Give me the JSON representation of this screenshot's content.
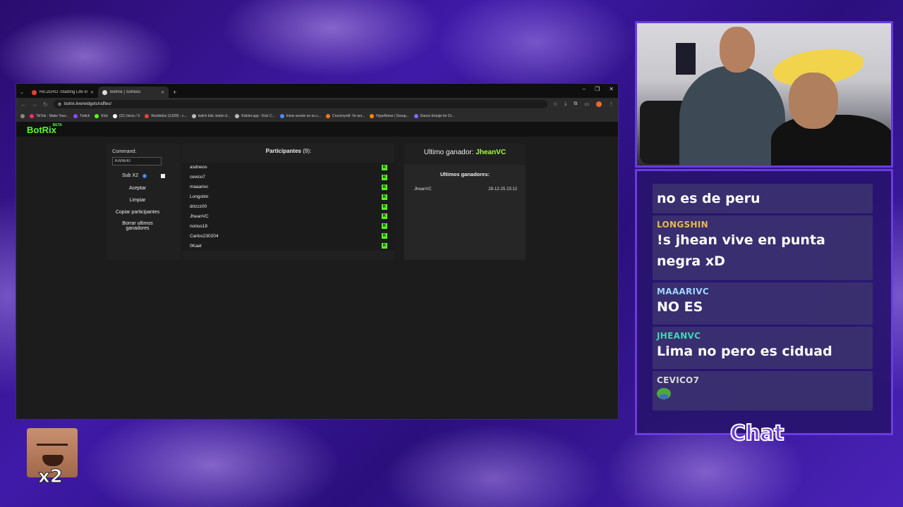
{
  "browser": {
    "tabs": [
      {
        "title": "Re:ZERO -Starting Life in Anoth",
        "favicon_color": "#e8442c",
        "active": false
      },
      {
        "title": "BotRix | Sorteos",
        "favicon_color": "#dddddd",
        "active": true
      }
    ],
    "url": "botrix.live/widgets/raffles/",
    "bookmarks": [
      {
        "label": "TikTok - Make Your...",
        "color": "#ff2a6d"
      },
      {
        "label": "Twitch",
        "color": "#9146ff"
      },
      {
        "label": "Kick",
        "color": "#53fc18"
      },
      {
        "label": "(31) Inicio / X",
        "color": "#ffffff"
      },
      {
        "label": "Recibidos (3,628) - c...",
        "color": "#ea4335"
      },
      {
        "label": "twitch bits: botón d...",
        "color": "#bbbbbb"
      },
      {
        "label": "Kicklet.app - Kick C...",
        "color": "#bbbbbb"
      },
      {
        "label": "Inicie sesión en su c...",
        "color": "#4a8cff"
      },
      {
        "label": "Crunchyroll: Ve ani...",
        "color": "#f47521"
      },
      {
        "label": "HypeNoise | Group...",
        "color": "#ff8a00"
      },
      {
        "label": "Dance Emojis for Di...",
        "color": "#7b6cff"
      }
    ]
  },
  "site": {
    "logo": "BotRix",
    "logo_badge": "BETA"
  },
  "raffle": {
    "command_label": "Command:",
    "command_value": "KANEKI",
    "sub_label": "Sub X2",
    "accept_label": "Aceptar",
    "clear_label": "Limpiar",
    "copy_label": "Copiar participantes",
    "delete_winners_label": "Borrar ultimos ganadores",
    "participants_title": "Participantes",
    "participants_count": "(9):",
    "participants": [
      "asdneos",
      "cevico7",
      "maaarivc",
      "Longshin",
      "drizzz00",
      "JheanVC",
      "norius18",
      "Carlos230204",
      "0Kael"
    ],
    "last_winner_label": "Ultimo ganador:",
    "last_winner": "JheanVC",
    "recent_winners_title": "Ultimos ganadores:",
    "recent_winners": [
      {
        "name": "JheanVC",
        "date": "28-12-25 23:12"
      }
    ]
  },
  "chat": {
    "label": "Chat",
    "messages": [
      {
        "user": "",
        "user_color": "#ffffff",
        "text": "no es de peru"
      },
      {
        "user": "LONGSHIN",
        "user_color": "#e8b94a",
        "text": "!s jhean vive en punta negra xD"
      },
      {
        "user": "MAAARIVC",
        "user_color": "#9fd4ff",
        "text": "NO ES"
      },
      {
        "user": "JHEANVC",
        "user_color": "#3fd6b4",
        "text": "Lima no pero es ciduad"
      },
      {
        "user": "CEVICO7",
        "user_color": "#d8d8d8",
        "text": ""
      }
    ]
  },
  "overlay": {
    "emote_multiplier": "x2"
  }
}
